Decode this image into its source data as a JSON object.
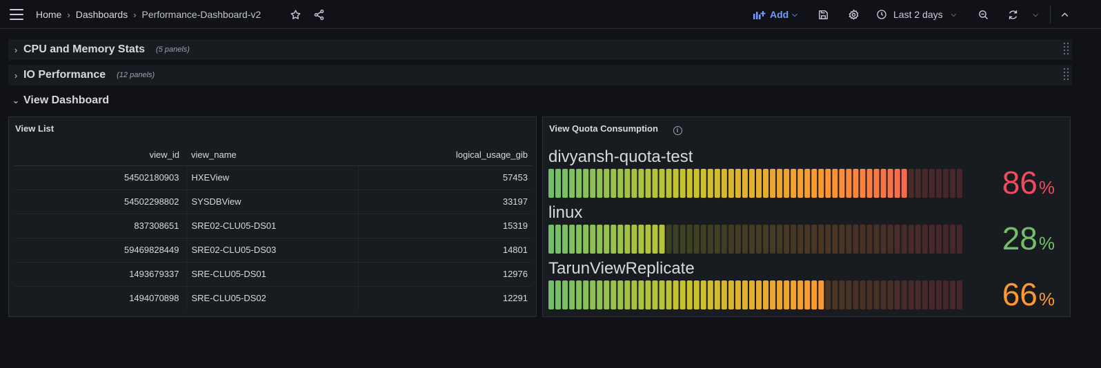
{
  "nav": {
    "home": "Home",
    "dashboards": "Dashboards",
    "current": "Performance-Dashboard-v2",
    "add_label": "Add",
    "time_range": "Last 2 days"
  },
  "rows": [
    {
      "title": "CPU and Memory Stats",
      "count": "(5 panels)",
      "collapsed": true
    },
    {
      "title": "IO Performance",
      "count": "(12 panels)",
      "collapsed": true
    },
    {
      "title": "View Dashboard",
      "collapsed": false
    }
  ],
  "view_list": {
    "title": "View List",
    "columns": [
      "view_id",
      "view_name",
      "logical_usage_gib"
    ],
    "rows": [
      [
        "54502180903",
        "HXEView",
        "57453"
      ],
      [
        "54502298802",
        "SYSDBView",
        "33197"
      ],
      [
        "837308651",
        "SRE02-CLU05-DS01",
        "15319"
      ],
      [
        "59469828449",
        "SRE02-CLU05-DS03",
        "14801"
      ],
      [
        "1493679337",
        "SRE-CLU05-DS01",
        "12976"
      ],
      [
        "1494070898",
        "SRE-CLU05-DS02",
        "12291"
      ]
    ]
  },
  "quota": {
    "title": "View Quota Consumption",
    "gauges": [
      {
        "name": "divyansh-quota-test",
        "value": 86,
        "unit": "%",
        "color": "#f2495c"
      },
      {
        "name": "linux",
        "value": 28,
        "unit": "%",
        "color": "#73bf69"
      },
      {
        "name": "TarunViewReplicate",
        "value": 66,
        "unit": "%",
        "color": "#ff9830"
      }
    ]
  },
  "colors": {
    "background": "#111217",
    "panel": "#181b1f",
    "accent": "#6e9fff",
    "gradient": [
      "#73bf69",
      "#c8c32f",
      "#ff9830",
      "#f2495c"
    ]
  }
}
